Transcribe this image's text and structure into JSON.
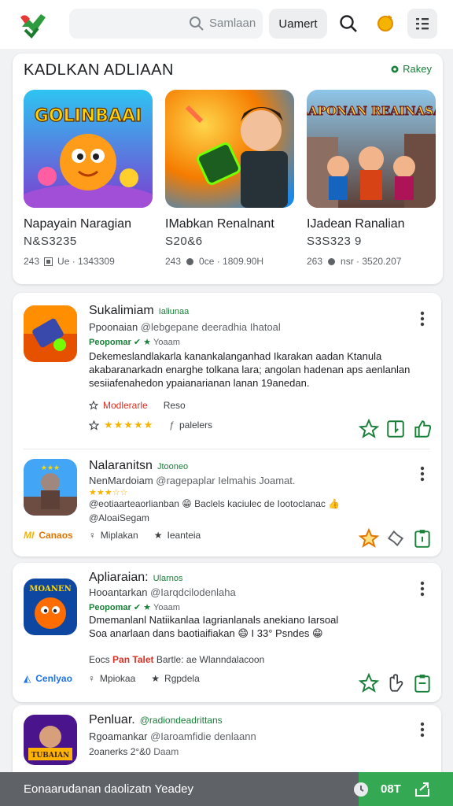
{
  "topbar": {
    "search_placeholder": "Samlaan",
    "menu_label": "Uamert"
  },
  "featured": {
    "title": "KADLKAN ADLIAAN",
    "link": "Rakey",
    "cards": [
      {
        "thumb_text": "GOLINBAAI",
        "name": "Napayain Naragian",
        "code": "N&S3235",
        "meta_a": "243",
        "meta_b": "Ue · 1343309"
      },
      {
        "thumb_text": "",
        "name": "IMabkan Renalnant",
        "code": "S20&6",
        "meta_a": "243",
        "meta_b": "0ce · 1809.90H"
      },
      {
        "thumb_text": "RAAPONAN REAINASAN",
        "name": "IJadean Ranalian",
        "code": "S3S323 9",
        "meta_a": "263",
        "meta_b": "nsr · 3520.207"
      }
    ]
  },
  "list": {
    "item1": {
      "title": "Sukalimiam",
      "badge": "Ialiunaa",
      "subtitle": "Ppoonaian",
      "handle": "@lebgepane deeradhia Ihatoal",
      "tag": "Peopomar ✔ ★",
      "tag_sub": "Yoaam",
      "description": "Dekemeslandlakarla kanankalanganhad Ikarakan aadan Ktanula akabaranarkadn enarghe tolkana lara; angolan hadenan aps aenlanlan sesiiafenahedon ypaianarianan lanan 19anedan.",
      "meta1_label": "Modlerarle",
      "meta1_value": "Reso",
      "meta2_value": "palelers",
      "rating": 5
    },
    "item2": {
      "title": "Nalaranitsn",
      "badge": "Jtooneo",
      "subtitle": "NenMardoiam",
      "handle": "@ragepaplar Ielmahis Joamat.",
      "rating": 3,
      "line1": "@eotiaarteaorlianban 😁 Baclels kaciulec de Iootoclanac 👍",
      "line2": "@AloaiSegam",
      "brand": "Canaos",
      "meta_a": "Miplakan",
      "meta_b": "Ieanteia"
    },
    "item3": {
      "title": "Apliaraian:",
      "badge": "Ularnos",
      "subtitle": "Hooantarkan",
      "handle": "@Iarqdcilodenlaha",
      "tag": "Peopomar ✔ ★",
      "tag_sub": "Yoaam",
      "description_l1": "Dmemanlanl Natiikanlaa Iagrianlanals anekiano Iarsoal",
      "description_l2": "Soa anarlaan dans baotiaifiakan 😄 I 33° Psndes 😁",
      "note_prefix": "Eocs",
      "note_red": "Pan Talet",
      "note_rest": "Bartle: ae Wlanndalacoon",
      "brand": "Cenlyao",
      "meta_a": "Mpiokaa",
      "meta_b": "Rgpdela"
    },
    "item4": {
      "title": "Penluar.",
      "badge": "@radiondeadrittans",
      "subtitle": "Rgoamankar",
      "handle": "@Iaroamfidie denlaann",
      "line": "2oanerks 2°&0",
      "line_sub": "Daam"
    }
  },
  "bottombar": {
    "text": "Eonaarudanan daolizatn  Yeadey",
    "count": "08T"
  },
  "colors": {
    "accent_green": "#188038",
    "star_gold": "#f4b400",
    "bottom_gray": "#5f6368",
    "bottom_green": "#34a853"
  }
}
